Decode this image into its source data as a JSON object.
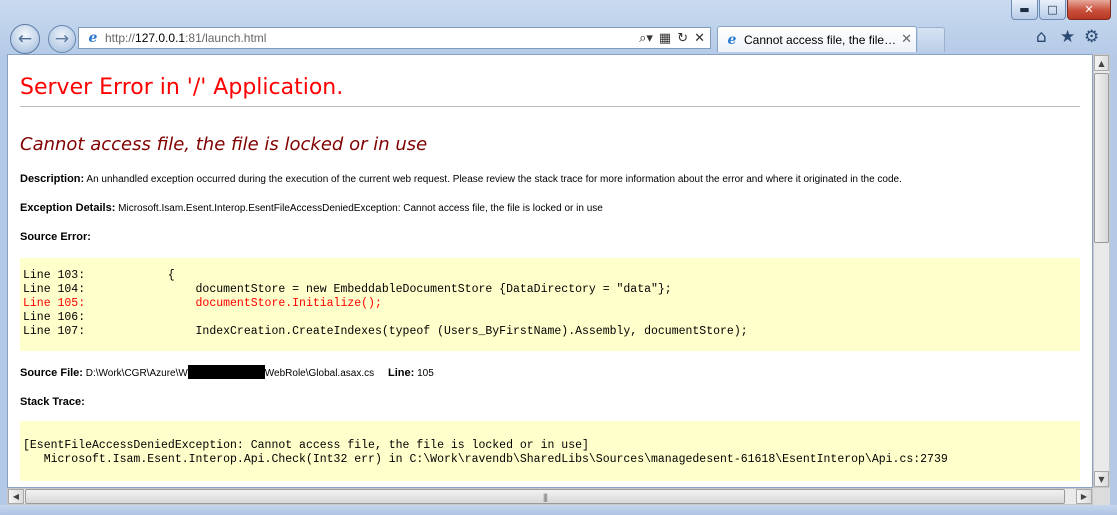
{
  "browser": {
    "url_scheme": "http://",
    "url_host": "127.0.0.1",
    "url_rest": ":81/launch.html",
    "tab_title": "Cannot access file, the file i...",
    "window_buttons": {
      "minimize": "▬",
      "maximize": "□",
      "close": "✕"
    },
    "icons": [
      "back-arrow-icon",
      "forward-arrow-icon",
      "ie-icon",
      "search-icon",
      "refresh-icon",
      "stop-icon",
      "home-icon",
      "favorites-star-icon",
      "tools-gear-icon"
    ]
  },
  "page": {
    "title": "Server Error in '/' Application.",
    "error_heading": "Cannot access file, the file is locked or in use",
    "description_label": "Description:",
    "description_text": "An unhandled exception occurred during the execution of the current web request. Please review the stack trace for more information about the error and where it originated in the code.",
    "exception_label": "Exception Details:",
    "exception_text": "Microsoft.Isam.Esent.Interop.EsentFileAccessDeniedException: Cannot access file, the file is locked or in use",
    "source_error_label": "Source Error:",
    "source_lines": [
      "Line 103:            {",
      "Line 104:                documentStore = new EmbeddableDocumentStore {DataDirectory = \"data\"};",
      "Line 105:                documentStore.Initialize();",
      "Line 106:",
      "Line 107:                IndexCreation.CreateIndexes(typeof (Users_ByFirstName).Assembly, documentStore);"
    ],
    "source_file_label": "Source File:",
    "source_file_prefix": "D:\\Work\\CGR\\Azure\\W",
    "source_file_suffix": "WebRole\\Global.asax.cs",
    "line_label": "Line:",
    "line_value": "105",
    "stack_trace_label": "Stack Trace:",
    "stack_lines": [
      "[EsentFileAccessDeniedException: Cannot access file, the file is locked or in use]",
      "   Microsoft.Isam.Esent.Interop.Api.Check(Int32 err) in C:\\Work\\ravendb\\SharedLibs\\Sources\\managedesent-61618\\EsentInterop\\Api.cs:2739"
    ]
  },
  "colors": {
    "title": "#ff0000",
    "heading": "#800000",
    "code_bg": "#ffffcc",
    "error_line": "#ff0000"
  }
}
